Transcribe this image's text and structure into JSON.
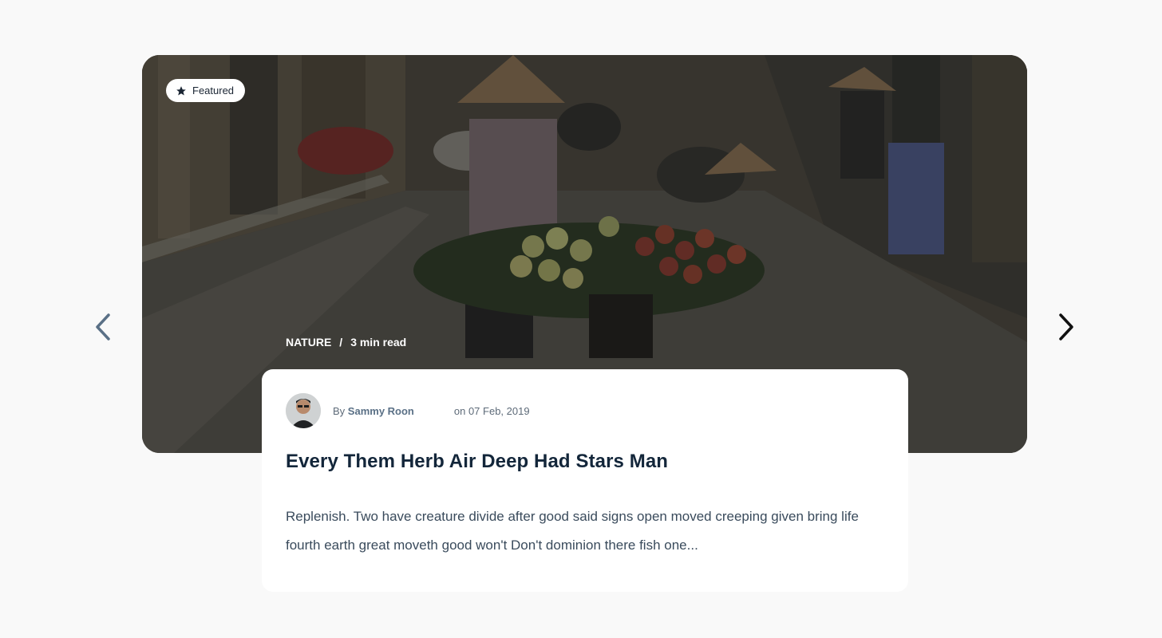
{
  "badge": {
    "label": "Featured",
    "icon": "star-icon"
  },
  "post": {
    "category": "NATURE",
    "separator": "/",
    "read_time": "3 min read",
    "author_prefix": "By",
    "author_name": "Sammy Roon",
    "date": "on 07 Feb, 2019",
    "title": "Every Them Herb Air Deep Had Stars Man",
    "excerpt": "Replenish. Two have creature divide after good said signs open moved creeping given bring life fourth earth great moveth good won't Don't dominion there fish one..."
  },
  "navigation": {
    "prev_icon": "chevron-left-icon",
    "next_icon": "chevron-right-icon"
  },
  "colors": {
    "page_background": "#f9f9f9",
    "title": "#13263a",
    "author_link": "#5a7086",
    "prev_arrow": "#5a7086",
    "next_arrow": "#111111"
  }
}
